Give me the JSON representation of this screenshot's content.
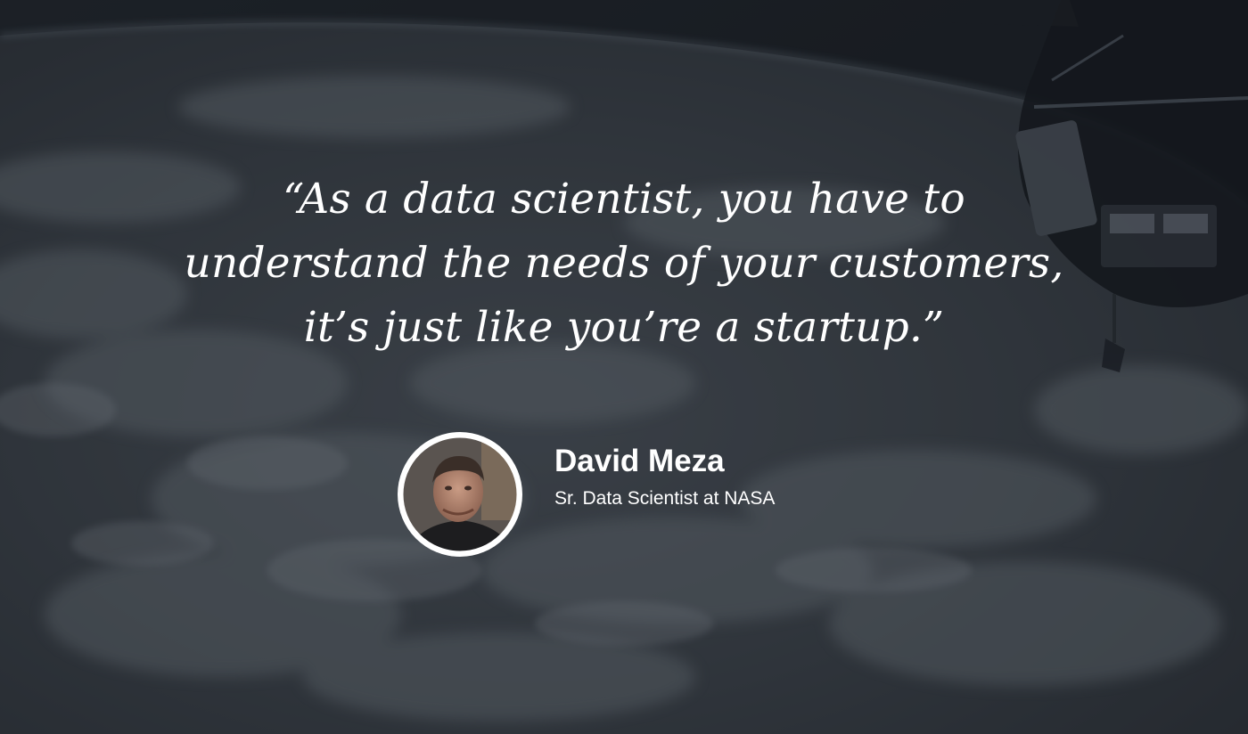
{
  "quote": {
    "lines": [
      "“As a data scientist, you have to",
      "understand the needs of your customers,",
      "it’s just like you’re a startup.”"
    ]
  },
  "speaker": {
    "name": "David Meza",
    "title": "Sr. Data Scientist at NASA"
  },
  "colors": {
    "background": "#2a2e33",
    "text": "#ffffff",
    "avatar_ring": "#ffffff"
  },
  "icons": {
    "satellite": "space-station-illustration",
    "avatar": "portrait-photo"
  }
}
